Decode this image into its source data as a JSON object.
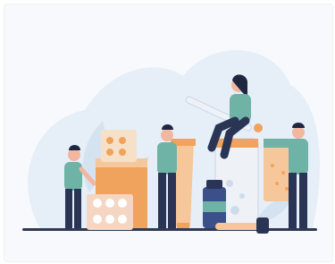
{
  "illustration": {
    "subject": "pharmacy-team-with-oversized-medicines",
    "colors": {
      "frame_background": "#f7f9fc",
      "blob": "#e6eef8",
      "leaf": "#d5e3f1",
      "ground": "#2f3a52",
      "teal_shirt": "#6fb3a6",
      "teal_dark": "#3f8f82",
      "navy": "#2a3556",
      "orange": "#f0a35c",
      "orange_light": "#f6c79b",
      "cream": "#f6e1c8",
      "skin": "#f2b7a0",
      "hair": "#1f2740",
      "pill_blister": "#f4d6c2",
      "bottle_blue": "#3b4f8a",
      "flask_glass": "#eef2f7"
    },
    "elements": [
      "background-blob",
      "leaf-decoration",
      "ground-line",
      "pill-box-tall",
      "blister-pack",
      "ointment-tube",
      "medicine-bottle",
      "glass-flask",
      "capsule-jar",
      "thermometer",
      "dropper",
      "person-pharmacist-left",
      "person-pharmacist-middle",
      "person-sitting-woman",
      "person-man-right"
    ]
  }
}
